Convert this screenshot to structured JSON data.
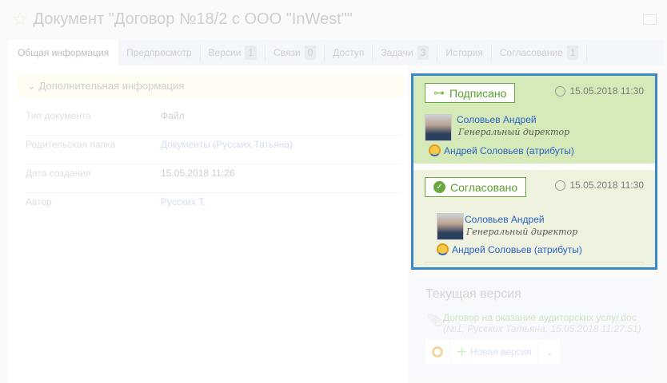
{
  "header": {
    "title": "Документ \"Договор №18/2 с ООО \"InWest\"\""
  },
  "tabs": [
    {
      "label": "Общая информация",
      "badge": null
    },
    {
      "label": "Предпросмотр",
      "badge": null
    },
    {
      "label": "Версии",
      "badge": "1"
    },
    {
      "label": "Связи",
      "badge": "0"
    },
    {
      "label": "Доступ",
      "badge": null
    },
    {
      "label": "Задачи",
      "badge": "3"
    },
    {
      "label": "История",
      "badge": null
    },
    {
      "label": "Согласование",
      "badge": "1"
    }
  ],
  "info": {
    "section": "Дополнительная информация",
    "rows": [
      {
        "k": "Тип документа",
        "v": "Файл"
      },
      {
        "k": "Родительская папка",
        "v": "Документы (Русских Татьяна)"
      },
      {
        "k": "Дата создания",
        "v": "15.05.2018 11:26"
      },
      {
        "k": "Автор",
        "v": "Русских Т."
      }
    ]
  },
  "signatures": [
    {
      "status": "Подписано",
      "time": "15.05.2018 11:30",
      "name": "Соловьев Андрей",
      "position": "Генеральный директор",
      "cert": "Андрей Соловьев (атрибуты)"
    },
    {
      "status": "Согласовано",
      "time": "15.05.2018 11:30",
      "name": "Соловьев Андрей",
      "position": "Генеральный директор",
      "cert": "Андрей Соловьев (атрибуты)"
    }
  ],
  "current": {
    "title": "Текущая версия",
    "file": "Договор на оказание аудиторских услуг.doc",
    "meta": "(№1, Русских Татьяна, 15.05.2018 11:27:51)",
    "new_version": "Новая версия"
  }
}
